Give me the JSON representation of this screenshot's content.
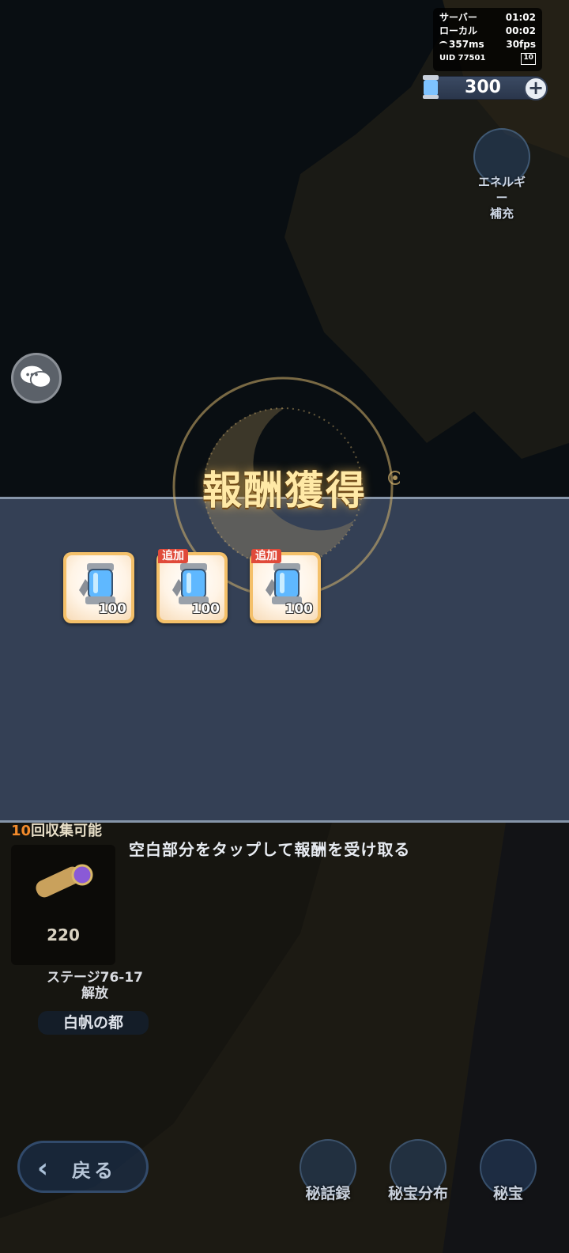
{
  "status": {
    "server_label": "サーバー",
    "server_time": "01:02",
    "local_label": "ローカル",
    "local_time": "00:02",
    "ping": "357ms",
    "fps": "30fps",
    "uid": "UID 77501",
    "badge": "10"
  },
  "energy": {
    "value": "300",
    "plus": "+"
  },
  "refill": {
    "label": "エネルギー\n補充"
  },
  "reward": {
    "title": "報酬獲得",
    "items": [
      {
        "qty": "100",
        "tag": ""
      },
      {
        "qty": "100",
        "tag": "追加"
      },
      {
        "qty": "100",
        "tag": "追加"
      }
    ],
    "hint": "空白部分をタップして報酬を受け取る"
  },
  "collect": {
    "count": "10",
    "label": "回収集可能",
    "price": "220"
  },
  "stage": {
    "label": "ステージ76-17\n解放",
    "city": "白帆の都"
  },
  "bottom": {
    "back": "戻る",
    "buttons": [
      "秘話録",
      "秘宝分布",
      "秘宝"
    ]
  },
  "colors": {
    "panel": "#3e4c64",
    "title": "#ffe9a6",
    "tag": "#e04a3a",
    "item_frame": "#f4c069"
  }
}
